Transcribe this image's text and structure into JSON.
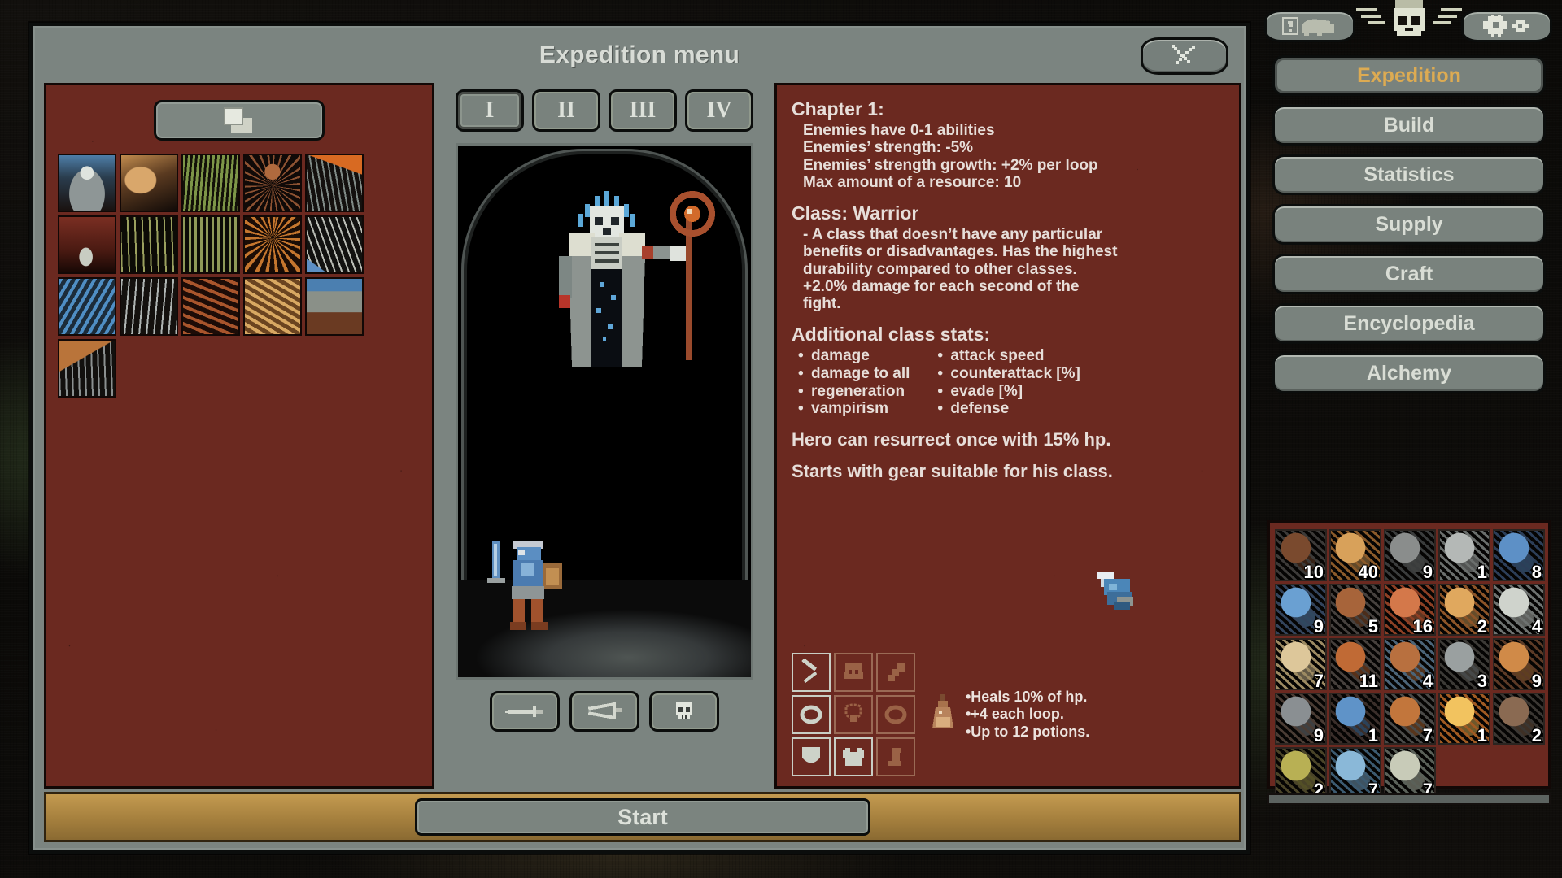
{
  "window": {
    "title": "Expedition menu",
    "close_icon": "crossed-bones-close-icon"
  },
  "chapter_tabs": [
    {
      "label": "I",
      "active": true
    },
    {
      "label": "II",
      "active": false
    },
    {
      "label": "III",
      "active": false
    },
    {
      "label": "IV",
      "active": false
    }
  ],
  "deck_button": {
    "icon": "cards-stack-icon"
  },
  "cards": [
    {
      "name": "lich-card"
    },
    {
      "name": "bones-card"
    },
    {
      "name": "grove-card"
    },
    {
      "name": "spider-cocoon-card"
    },
    {
      "name": "battlefield-card"
    },
    {
      "name": "blood-grove-card"
    },
    {
      "name": "thicket-card"
    },
    {
      "name": "forest-card"
    },
    {
      "name": "blood-tree-card"
    },
    {
      "name": "ransacked-village-card"
    },
    {
      "name": "river-card"
    },
    {
      "name": "arsenal-card"
    },
    {
      "name": "wheat-field-card"
    },
    {
      "name": "desert-card"
    },
    {
      "name": "village-card"
    },
    {
      "name": "outpost-card"
    }
  ],
  "mode_buttons": [
    {
      "name": "single-sword-mode",
      "icon": "sword-icon"
    },
    {
      "name": "crossed-swords-mode",
      "icon": "crossed-swords-icon"
    },
    {
      "name": "skull-mode",
      "icon": "skull-icon"
    }
  ],
  "info": {
    "chapter_heading": "Chapter 1:",
    "chapter_lines": [
      "Enemies have 0-1 abilities",
      "Enemies’ strength: -5%",
      "Enemies’ strength growth: +2% per loop",
      "Max amount of a resource: 10"
    ],
    "class_heading": "Class: Warrior",
    "class_lines": [
      "- A class that doesn’t have any particular",
      "benefits or disadvantages. Has the highest",
      "durability compared to other classes.",
      "+2.0% damage for each second of the",
      "fight."
    ],
    "stats_heading": "Additional class stats:",
    "stats_left": [
      "damage",
      "damage to all",
      "regeneration",
      "vampirism"
    ],
    "stats_right": [
      "attack speed",
      "counterattack [%]",
      "evade [%]",
      "defense"
    ],
    "resurrect_text": "Hero can resurrect once with 15% hp.",
    "gear_text": "Starts with gear suitable for his class."
  },
  "gear_slots": [
    {
      "name": "weapon-slot",
      "icon": "sword-icon",
      "filled": true
    },
    {
      "name": "helmet-slot",
      "icon": "helmet-icon",
      "filled": false
    },
    {
      "name": "gloves-slot",
      "icon": "gloves-icon",
      "filled": false
    },
    {
      "name": "ring-left-slot",
      "icon": "ring-icon",
      "filled": true
    },
    {
      "name": "amulet-slot",
      "icon": "amulet-icon",
      "filled": false
    },
    {
      "name": "ring-right-slot",
      "icon": "ring-icon",
      "filled": false
    },
    {
      "name": "shield-slot",
      "icon": "shield-icon",
      "filled": true
    },
    {
      "name": "armor-slot",
      "icon": "armor-icon",
      "filled": true
    },
    {
      "name": "boots-slot",
      "icon": "boots-icon",
      "filled": false
    }
  ],
  "potion": {
    "icon": "potion-flask-icon",
    "lines": [
      "•Heals 10% of hp.",
      "•+4 each loop.",
      "•Up to 12 potions."
    ]
  },
  "start_button": {
    "label": "Start"
  },
  "sidebar": {
    "help_icon": "help-elephant-icon",
    "settings_icon": "gear-icon",
    "emblem_icon": "winged-skull-emblem-icon",
    "nav": [
      {
        "label": "Expedition",
        "active": true
      },
      {
        "label": "Build",
        "active": false
      },
      {
        "label": "Statistics",
        "active": false
      },
      {
        "label": "Supply",
        "active": false
      },
      {
        "label": "Craft",
        "active": false
      },
      {
        "label": "Encyclopedia",
        "active": false
      },
      {
        "label": "Alchemy",
        "active": false
      }
    ]
  },
  "inventory": [
    {
      "name": "item-branch",
      "count": "10",
      "c1": "#7a4a2e",
      "c2": "#3c3a38"
    },
    {
      "name": "item-wheat",
      "count": "40",
      "c1": "#d8a15a",
      "c2": "#8a5a2a"
    },
    {
      "name": "item-stone-dust",
      "count": "9",
      "c1": "#8a8d8c",
      "c2": "#3a3c3c"
    },
    {
      "name": "item-stone",
      "count": "1",
      "c1": "#b4b8b6",
      "c2": "#6a6e6c"
    },
    {
      "name": "item-blue-shard",
      "count": "8",
      "c1": "#5d90c6",
      "c2": "#2c3e58"
    },
    {
      "name": "item-blue-orb",
      "count": "9",
      "c1": "#6aa0d2",
      "c2": "#33445c"
    },
    {
      "name": "item-copper-ore",
      "count": "5",
      "c1": "#a7643a",
      "c2": "#46413e"
    },
    {
      "name": "item-meat",
      "count": "16",
      "c1": "#d4784a",
      "c2": "#8c3f24"
    },
    {
      "name": "item-amber",
      "count": "2",
      "c1": "#e0a85e",
      "c2": "#8c5428"
    },
    {
      "name": "item-skull",
      "count": "4",
      "c1": "#cfd3cc",
      "c2": "#6e7270"
    },
    {
      "name": "item-scroll",
      "count": "7",
      "c1": "#ddc79a",
      "c2": "#9c8a62"
    },
    {
      "name": "item-claw",
      "count": "11",
      "c1": "#c06a35",
      "c2": "#46403c"
    },
    {
      "name": "item-fish",
      "count": "4",
      "c1": "#b8703f",
      "c2": "#4b6478"
    },
    {
      "name": "item-iron-scrap",
      "count": "3",
      "c1": "#9aa0a0",
      "c2": "#3c3a36"
    },
    {
      "name": "item-fangs",
      "count": "9",
      "c1": "#d08a48",
      "c2": "#5c3a26"
    },
    {
      "name": "item-bone-ring",
      "count": "9",
      "c1": "#8a8f92",
      "c2": "#4a3c34"
    },
    {
      "name": "item-blue-gem",
      "count": "1",
      "c1": "#5f93c8",
      "c2": "#3a2e2a"
    },
    {
      "name": "item-horn",
      "count": "7",
      "c1": "#c2763c",
      "c2": "#4a4a48"
    },
    {
      "name": "item-gold-orb",
      "count": "1",
      "c1": "#f2c35f",
      "c2": "#a05a22"
    },
    {
      "name": "item-ash",
      "count": "2",
      "c1": "#8a6a52",
      "c2": "#3a3632"
    },
    {
      "name": "item-moss",
      "count": "2",
      "c1": "#b8b054",
      "c2": "#4a4428"
    },
    {
      "name": "item-ice-orb",
      "count": "7",
      "c1": "#8ab8d8",
      "c2": "#3c5a70"
    },
    {
      "name": "item-pale-skull",
      "count": "7",
      "c1": "#c8cbb8",
      "c2": "#5a6058"
    }
  ],
  "cursor": {
    "icon": "gauntlet-cursor-icon"
  },
  "colors": {
    "steel": "#7b8480",
    "panel_red": "#6b2920",
    "accent_gold": "#ddab52",
    "text_light": "#d9ddd5",
    "start_bar": "#a8823f"
  }
}
